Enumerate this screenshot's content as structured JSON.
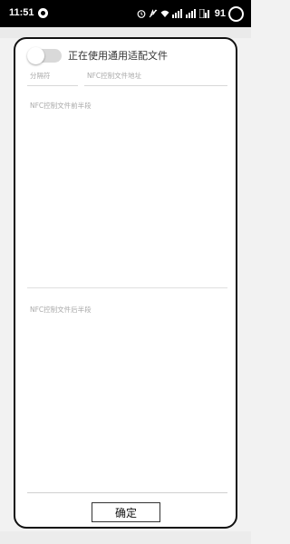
{
  "status_bar": {
    "time": "11:51",
    "battery_level": "91",
    "icons": [
      "alarm-icon",
      "do-not-disturb-icon",
      "wifi-icon",
      "signal-icon",
      "signal-icon",
      "hd-signal-icon"
    ]
  },
  "dialog": {
    "toggle_label": "正在使用通用适配文件",
    "toggle_on": false,
    "separator_placeholder": "分隔符",
    "address_placeholder": "NFC控制文件地址",
    "front_placeholder": "NFC控制文件前半段",
    "back_placeholder": "NFC控制文件后半段",
    "confirm_label": "确定"
  }
}
